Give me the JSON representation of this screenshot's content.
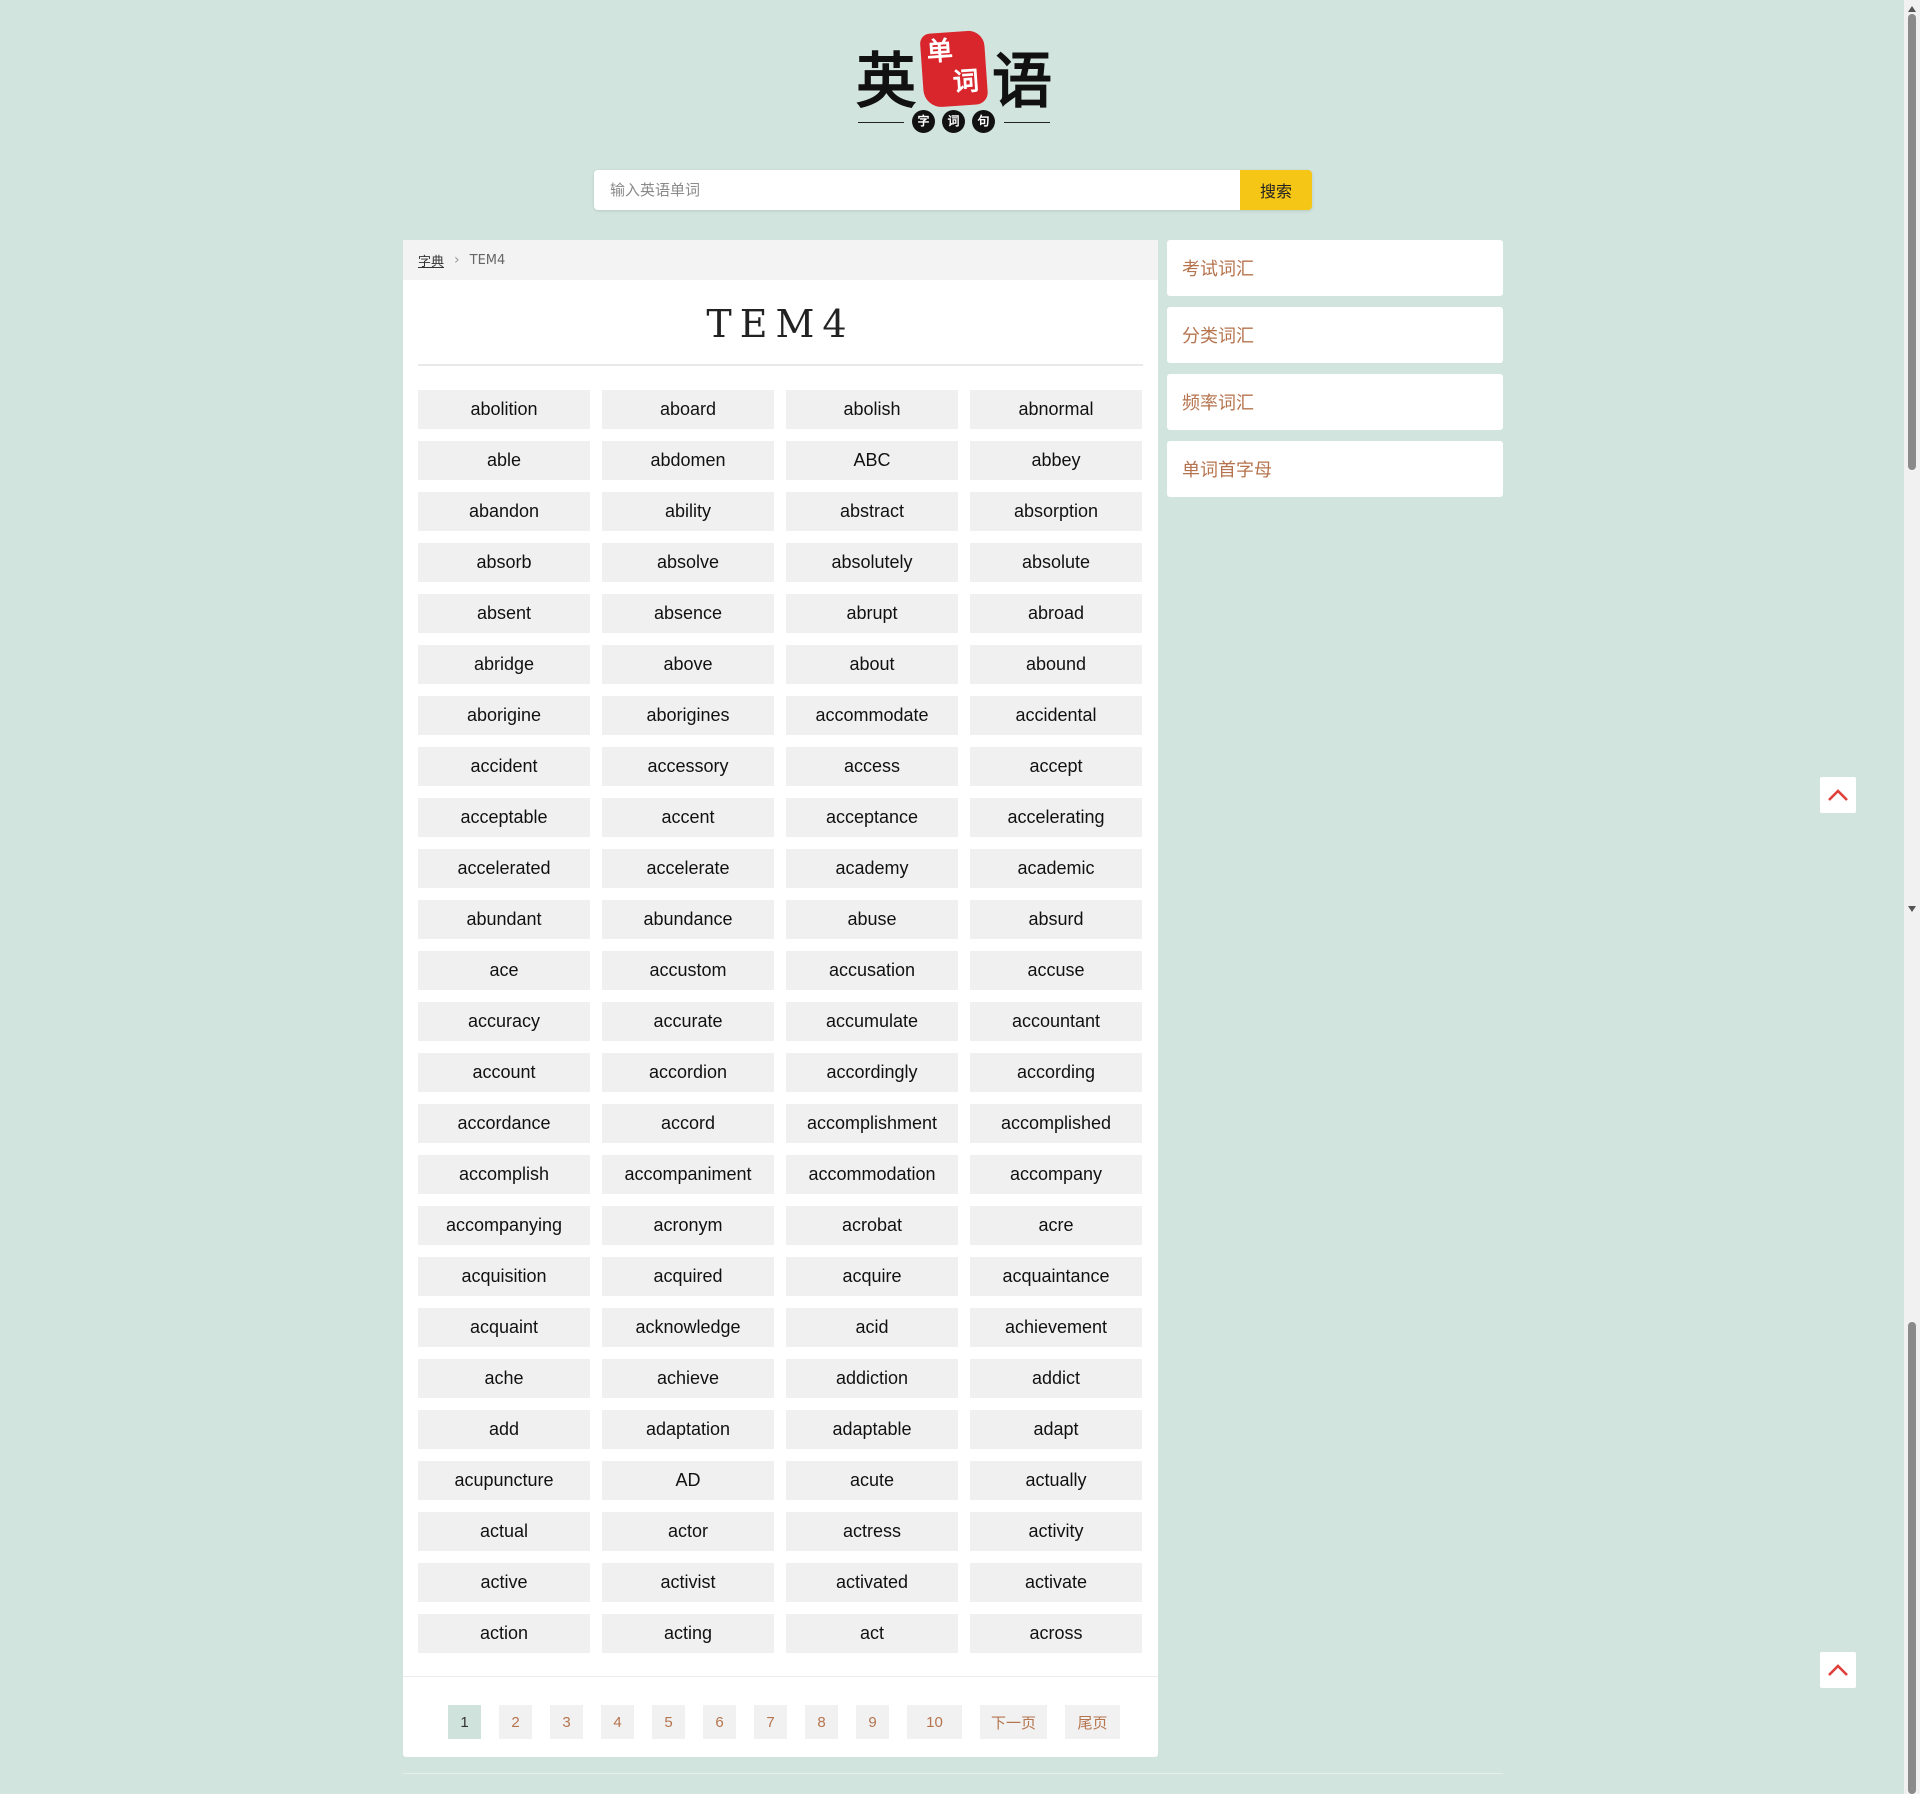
{
  "logo": {
    "char_left": "英",
    "seal_top": "单",
    "seal_bottom": "词",
    "char_right": "语",
    "small_1": "字",
    "small_2": "词",
    "small_3": "句"
  },
  "search": {
    "placeholder": "输入英语单词",
    "button_label": "搜索"
  },
  "breadcrumb": {
    "home": "字典",
    "current": "TEM4"
  },
  "page_title": "TEM4",
  "words": [
    "abolition",
    "aboard",
    "abolish",
    "abnormal",
    "able",
    "abdomen",
    "ABC",
    "abbey",
    "abandon",
    "ability",
    "abstract",
    "absorption",
    "absorb",
    "absolve",
    "absolutely",
    "absolute",
    "absent",
    "absence",
    "abrupt",
    "abroad",
    "abridge",
    "above",
    "about",
    "abound",
    "aborigine",
    "aborigines",
    "accommodate",
    "accidental",
    "accident",
    "accessory",
    "access",
    "accept",
    "acceptable",
    "accent",
    "acceptance",
    "accelerating",
    "accelerated",
    "accelerate",
    "academy",
    "academic",
    "abundant",
    "abundance",
    "abuse",
    "absurd",
    "ace",
    "accustom",
    "accusation",
    "accuse",
    "accuracy",
    "accurate",
    "accumulate",
    "accountant",
    "account",
    "accordion",
    "accordingly",
    "according",
    "accordance",
    "accord",
    "accomplishment",
    "accomplished",
    "accomplish",
    "accompaniment",
    "accommodation",
    "accompany",
    "accompanying",
    "acronym",
    "acrobat",
    "acre",
    "acquisition",
    "acquired",
    "acquire",
    "acquaintance",
    "acquaint",
    "acknowledge",
    "acid",
    "achievement",
    "ache",
    "achieve",
    "addiction",
    "addict",
    "add",
    "adaptation",
    "adaptable",
    "adapt",
    "acupuncture",
    "AD",
    "acute",
    "actually",
    "actual",
    "actor",
    "actress",
    "activity",
    "active",
    "activist",
    "activated",
    "activate",
    "action",
    "acting",
    "act",
    "across"
  ],
  "pagination": {
    "current": "1",
    "pages": [
      "2",
      "3",
      "4",
      "5",
      "6",
      "7",
      "8",
      "9",
      "10"
    ],
    "next": "下一页",
    "last": "尾页"
  },
  "sidebar": {
    "items": [
      {
        "label": "考试词汇"
      },
      {
        "label": "分类词汇"
      },
      {
        "label": "频率词汇"
      },
      {
        "label": "单词首字母"
      }
    ]
  },
  "icons": {
    "back_to_top": "chevron-up-icon"
  },
  "colors": {
    "background": "#d2e4de",
    "accent_link": "#b5744e",
    "search_button": "#f6c616",
    "seal_red": "#d9262c"
  }
}
